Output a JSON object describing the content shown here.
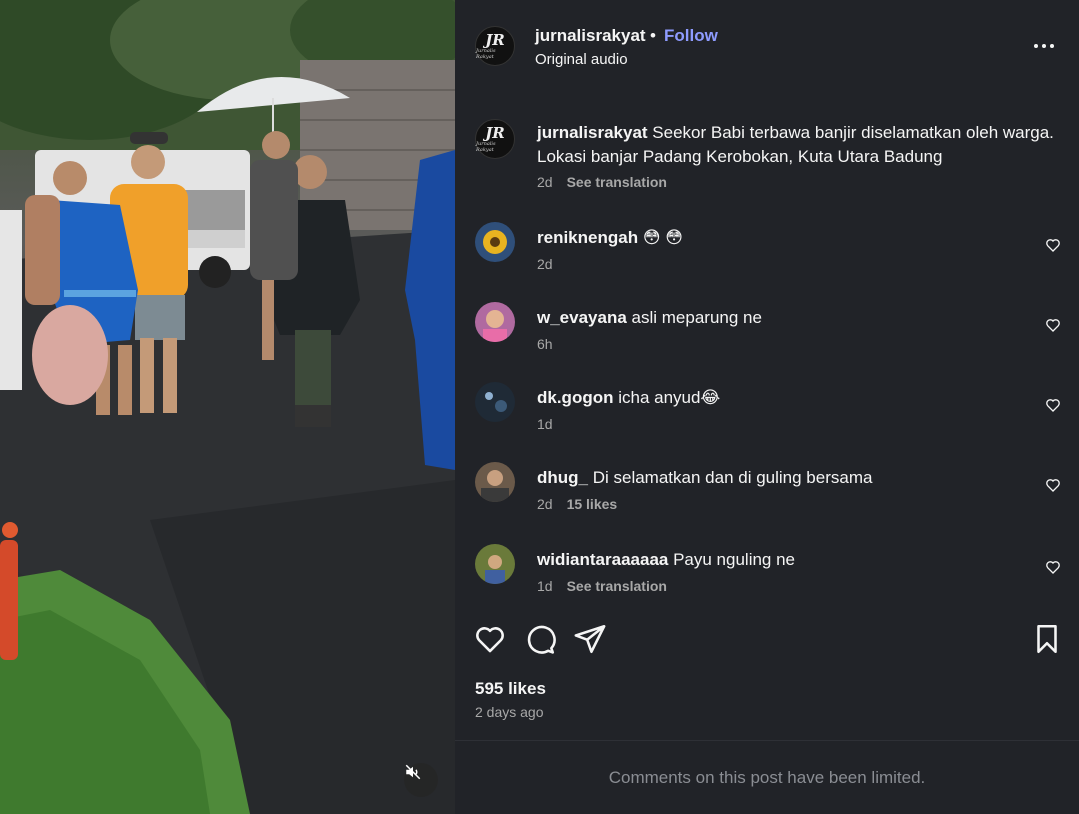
{
  "post": {
    "username": "jurnalisrakyat",
    "dot": "•",
    "follow_label": "Follow",
    "audio_label": "Original audio",
    "avatar_text": "JR",
    "avatar_subtext": "Jurnalis Rakyat",
    "more_icon": "more-horizontal-icon"
  },
  "caption": {
    "username": "jurnalisrakyat",
    "text": " Seekor Babi terbawa banjir diselamatkan oleh warga. Lokasi banjar Padang Kerobokan, Kuta Utara Badung",
    "time": "2d",
    "translate_label": "See translation"
  },
  "comments": [
    {
      "username": "reniknengah",
      "text": " 😳 😳",
      "time": "2d",
      "extra": "",
      "avatar_color": "#2f4f7a"
    },
    {
      "username": "w_evayana",
      "text": " asli meparung ne",
      "time": "6h",
      "extra": "",
      "avatar_color": "#b06aa0"
    },
    {
      "username": "dk.gogon",
      "text": " icha anyud😂",
      "time": "1d",
      "extra": "",
      "avatar_color": "#1f2a36"
    },
    {
      "username": "dhug_",
      "text": "  Di selamatkan dan di guling bersama",
      "time": "2d",
      "extra": "15 likes",
      "avatar_color": "#6b5a4a"
    },
    {
      "username": "widiantaraaaaaa",
      "text": " Payu nguling ne",
      "time": "1d",
      "extra": "See translation",
      "avatar_color": "#6a7a3a"
    }
  ],
  "actions": {
    "like_icon": "heart-icon",
    "comment_icon": "comment-icon",
    "share_icon": "share-icon",
    "save_icon": "bookmark-icon"
  },
  "likes": "595 likes",
  "time_ago": "2 days ago",
  "limited_text": "Comments on this post have been limited.",
  "video": {
    "mute_icon": "muted-speaker-icon"
  },
  "colors": {
    "panel_bg": "#212328",
    "follow": "#8e9bff",
    "muted_text": "#a8a8a8"
  }
}
